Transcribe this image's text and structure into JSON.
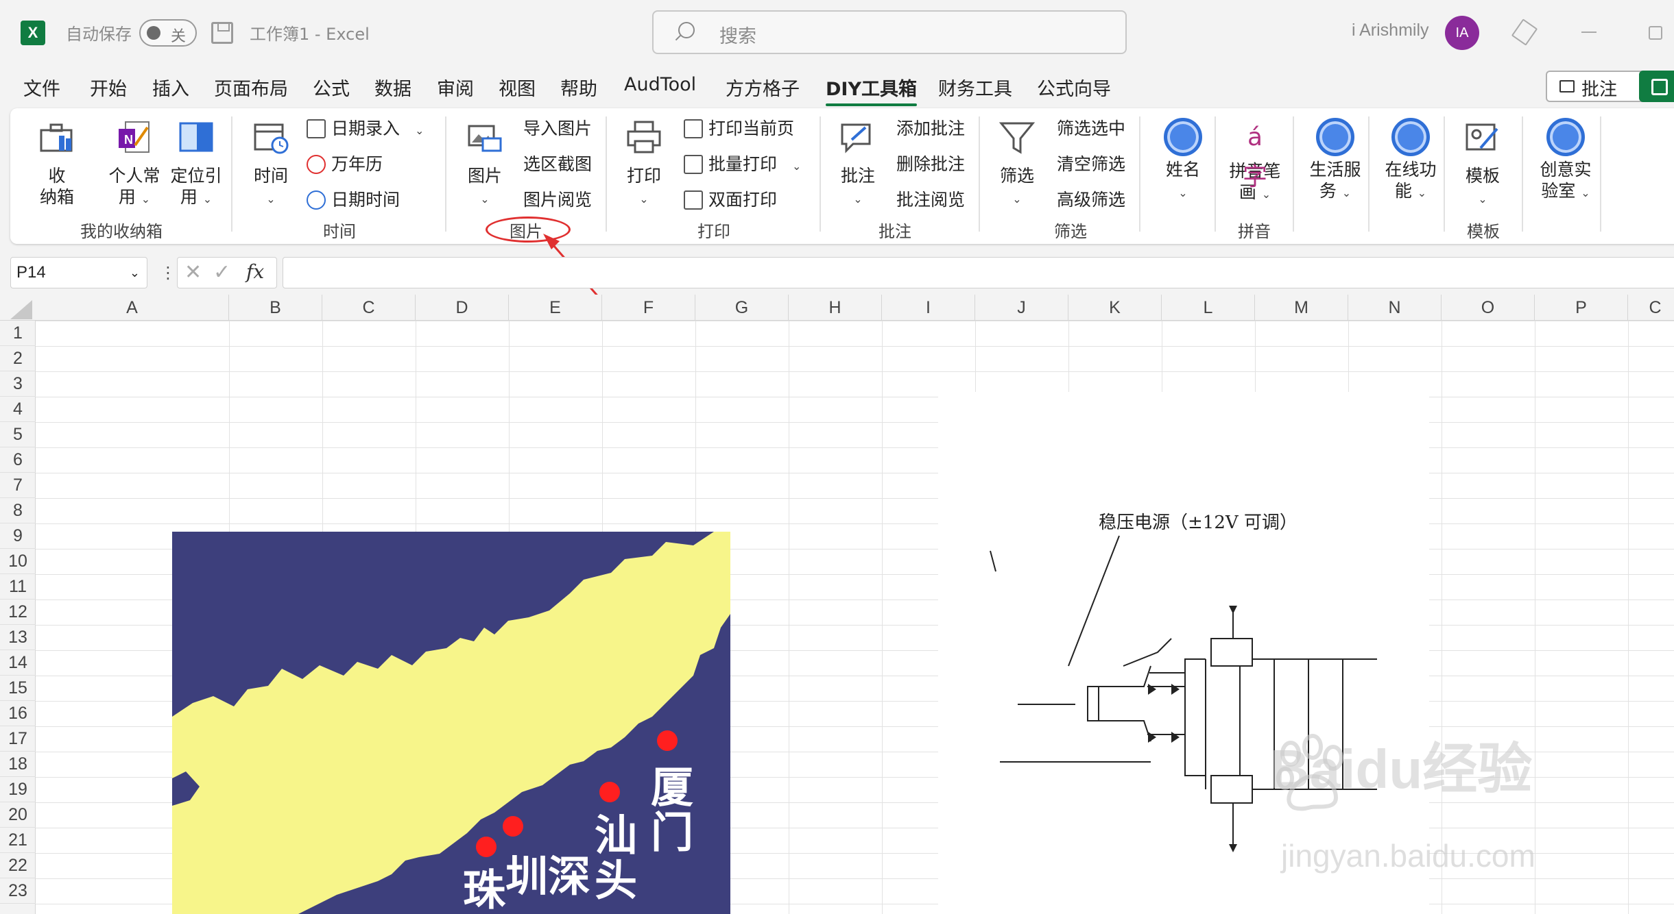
{
  "titlebar": {
    "app_logo": "X",
    "autosave_label": "自动保存",
    "autosave_state": "关",
    "document_title": "工作簿1  -  Excel",
    "search_placeholder": "搜索",
    "user_name": "i Arishmily",
    "avatar_initials": "IA"
  },
  "menu": {
    "tabs": [
      "文件",
      "开始",
      "插入",
      "页面布局",
      "公式",
      "数据",
      "审阅",
      "视图",
      "帮助",
      "AudTool",
      "方方格子",
      "DIY工具箱",
      "财务工具",
      "公式向导"
    ],
    "active_tab": "DIY工具箱",
    "comment_button": "批注"
  },
  "ribbon": {
    "groups": {
      "storage": {
        "label": "我的收纳箱",
        "storage_btn": "收\n纳箱",
        "personal_btn": "个人常\n用",
        "locate_btn": "定位引\n用"
      },
      "time": {
        "label": "时间",
        "time_btn": "时间",
        "date_entry": "日期录入",
        "calendar": "万年历",
        "datetime": "日期时间"
      },
      "picture": {
        "label": "图片",
        "picture_btn": "图片",
        "import_pic": "导入图片",
        "screenshot": "选区截图",
        "browse": "图片阅览"
      },
      "print": {
        "label": "打印",
        "print_btn": "打印",
        "print_current": "打印当前页",
        "batch_print": "批量打印",
        "duplex_print": "双面打印"
      },
      "comment": {
        "label": "批注",
        "comment_btn": "批注",
        "add_comment": "添加批注",
        "delete_comment": "删除批注",
        "browse_comment": "批注阅览"
      },
      "filter": {
        "label": "筛选",
        "filter_btn": "筛选",
        "filter_selected": "筛选选中",
        "clear_filter": "清空筛选",
        "advanced_filter": "高级筛选"
      },
      "name": {
        "name_btn": "姓名"
      },
      "pinyin": {
        "label": "拼音",
        "pinyin_btn": "拼音笔\n画",
        "icon_glyph": "á字"
      },
      "life": {
        "life_btn": "生活服\n务"
      },
      "online": {
        "online_btn": "在线功\n能"
      },
      "template": {
        "label": "模板",
        "template_btn": "模板"
      },
      "lab": {
        "lab_btn": "创意实\n验室"
      }
    }
  },
  "formula_bar": {
    "name_box": "P14",
    "fx": "fx",
    "formula": ""
  },
  "sheet": {
    "columns": [
      "A",
      "B",
      "C",
      "D",
      "E",
      "F",
      "G",
      "H",
      "I",
      "J",
      "K",
      "L",
      "M",
      "N",
      "O",
      "P",
      "C"
    ],
    "rows": [
      "1",
      "2",
      "3",
      "4",
      "5",
      "6",
      "7",
      "8",
      "9",
      "10",
      "11",
      "12",
      "13",
      "14",
      "15",
      "16",
      "17",
      "18",
      "19",
      "20",
      "21",
      "22",
      "23"
    ]
  },
  "map_image": {
    "cities": [
      "厦门",
      "汕头",
      "深圳",
      "珠"
    ],
    "colors": {
      "sea": "#3d3f7c",
      "land": "#f7f58a",
      "marker": "#ff1f1f"
    }
  },
  "circuit_image": {
    "title": "稳压电源（±12V 可调）"
  },
  "watermark": {
    "brand": "Baidu经验",
    "url": "jingyan.baidu.com"
  },
  "colors": {
    "accent": "#107c41",
    "annotation": "#e03030"
  }
}
